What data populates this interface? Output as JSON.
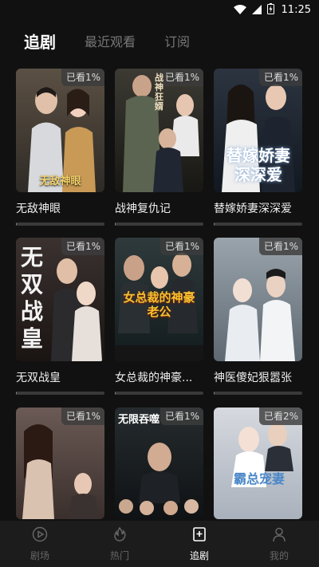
{
  "status": {
    "time": "11:25",
    "icons": [
      "wifi-icon",
      "signal-icon",
      "battery-charging-icon"
    ]
  },
  "tabs": [
    {
      "label": "追剧",
      "active": true
    },
    {
      "label": "最近观看",
      "active": false
    },
    {
      "label": "订阅",
      "active": false
    }
  ],
  "dramas": [
    {
      "title": "无敌神眼",
      "badge": "已看1%",
      "progress": 0.01,
      "poster_text": "无敌神眼",
      "colors": [
        "#5b5044",
        "#2e2a25"
      ]
    },
    {
      "title": "战神复仇记",
      "badge": "已看1%",
      "progress": 0.01,
      "poster_text": "战神狂婿",
      "colors": [
        "#3c3a33",
        "#181713"
      ]
    },
    {
      "title": "替嫁娇妻深深爱",
      "badge": "已看1%",
      "progress": 0.01,
      "poster_text": "替嫁娇妻深深爱",
      "colors": [
        "#2c3440",
        "#121820"
      ]
    },
    {
      "title": "无双战皇",
      "badge": "已看1%",
      "progress": 0.01,
      "poster_text": "无双战皇",
      "colors": [
        "#3b3230",
        "#1a1412"
      ]
    },
    {
      "title": "女总裁的神豪...",
      "badge": "已看1%",
      "progress": 0.01,
      "poster_text": "女总裁的神豪老公",
      "colors": [
        "#2f3a3c",
        "#121b1c"
      ]
    },
    {
      "title": "神医傻妃狠嚣张",
      "badge": "已看1%",
      "progress": 0.01,
      "poster_text": "",
      "colors": [
        "#9aa4ad",
        "#5e6870"
      ]
    },
    {
      "title": "",
      "badge": "已看1%",
      "progress": 0.01,
      "poster_text": "",
      "colors": [
        "#6b5a55",
        "#3a2f2c"
      ]
    },
    {
      "title": "",
      "badge": "已看1%",
      "progress": 0.01,
      "poster_text": "无限吞噬",
      "colors": [
        "#252b2e",
        "#0f1214"
      ]
    },
    {
      "title": "",
      "badge": "已看2%",
      "progress": 0.02,
      "poster_text": "霸总宠妻",
      "colors": [
        "#d6d9df",
        "#a9b1bc"
      ]
    }
  ],
  "nav": [
    {
      "label": "剧场",
      "icon": "play-circle-icon",
      "active": false
    },
    {
      "label": "热门",
      "icon": "flame-icon",
      "active": false
    },
    {
      "label": "追剧",
      "icon": "bookmark-plus-icon",
      "active": true
    },
    {
      "label": "我的",
      "icon": "person-icon",
      "active": false
    }
  ],
  "colors": {
    "background": "#111111",
    "nav_background": "#1c1c1c",
    "active_text": "#ffffff",
    "inactive_text": "#777777"
  }
}
